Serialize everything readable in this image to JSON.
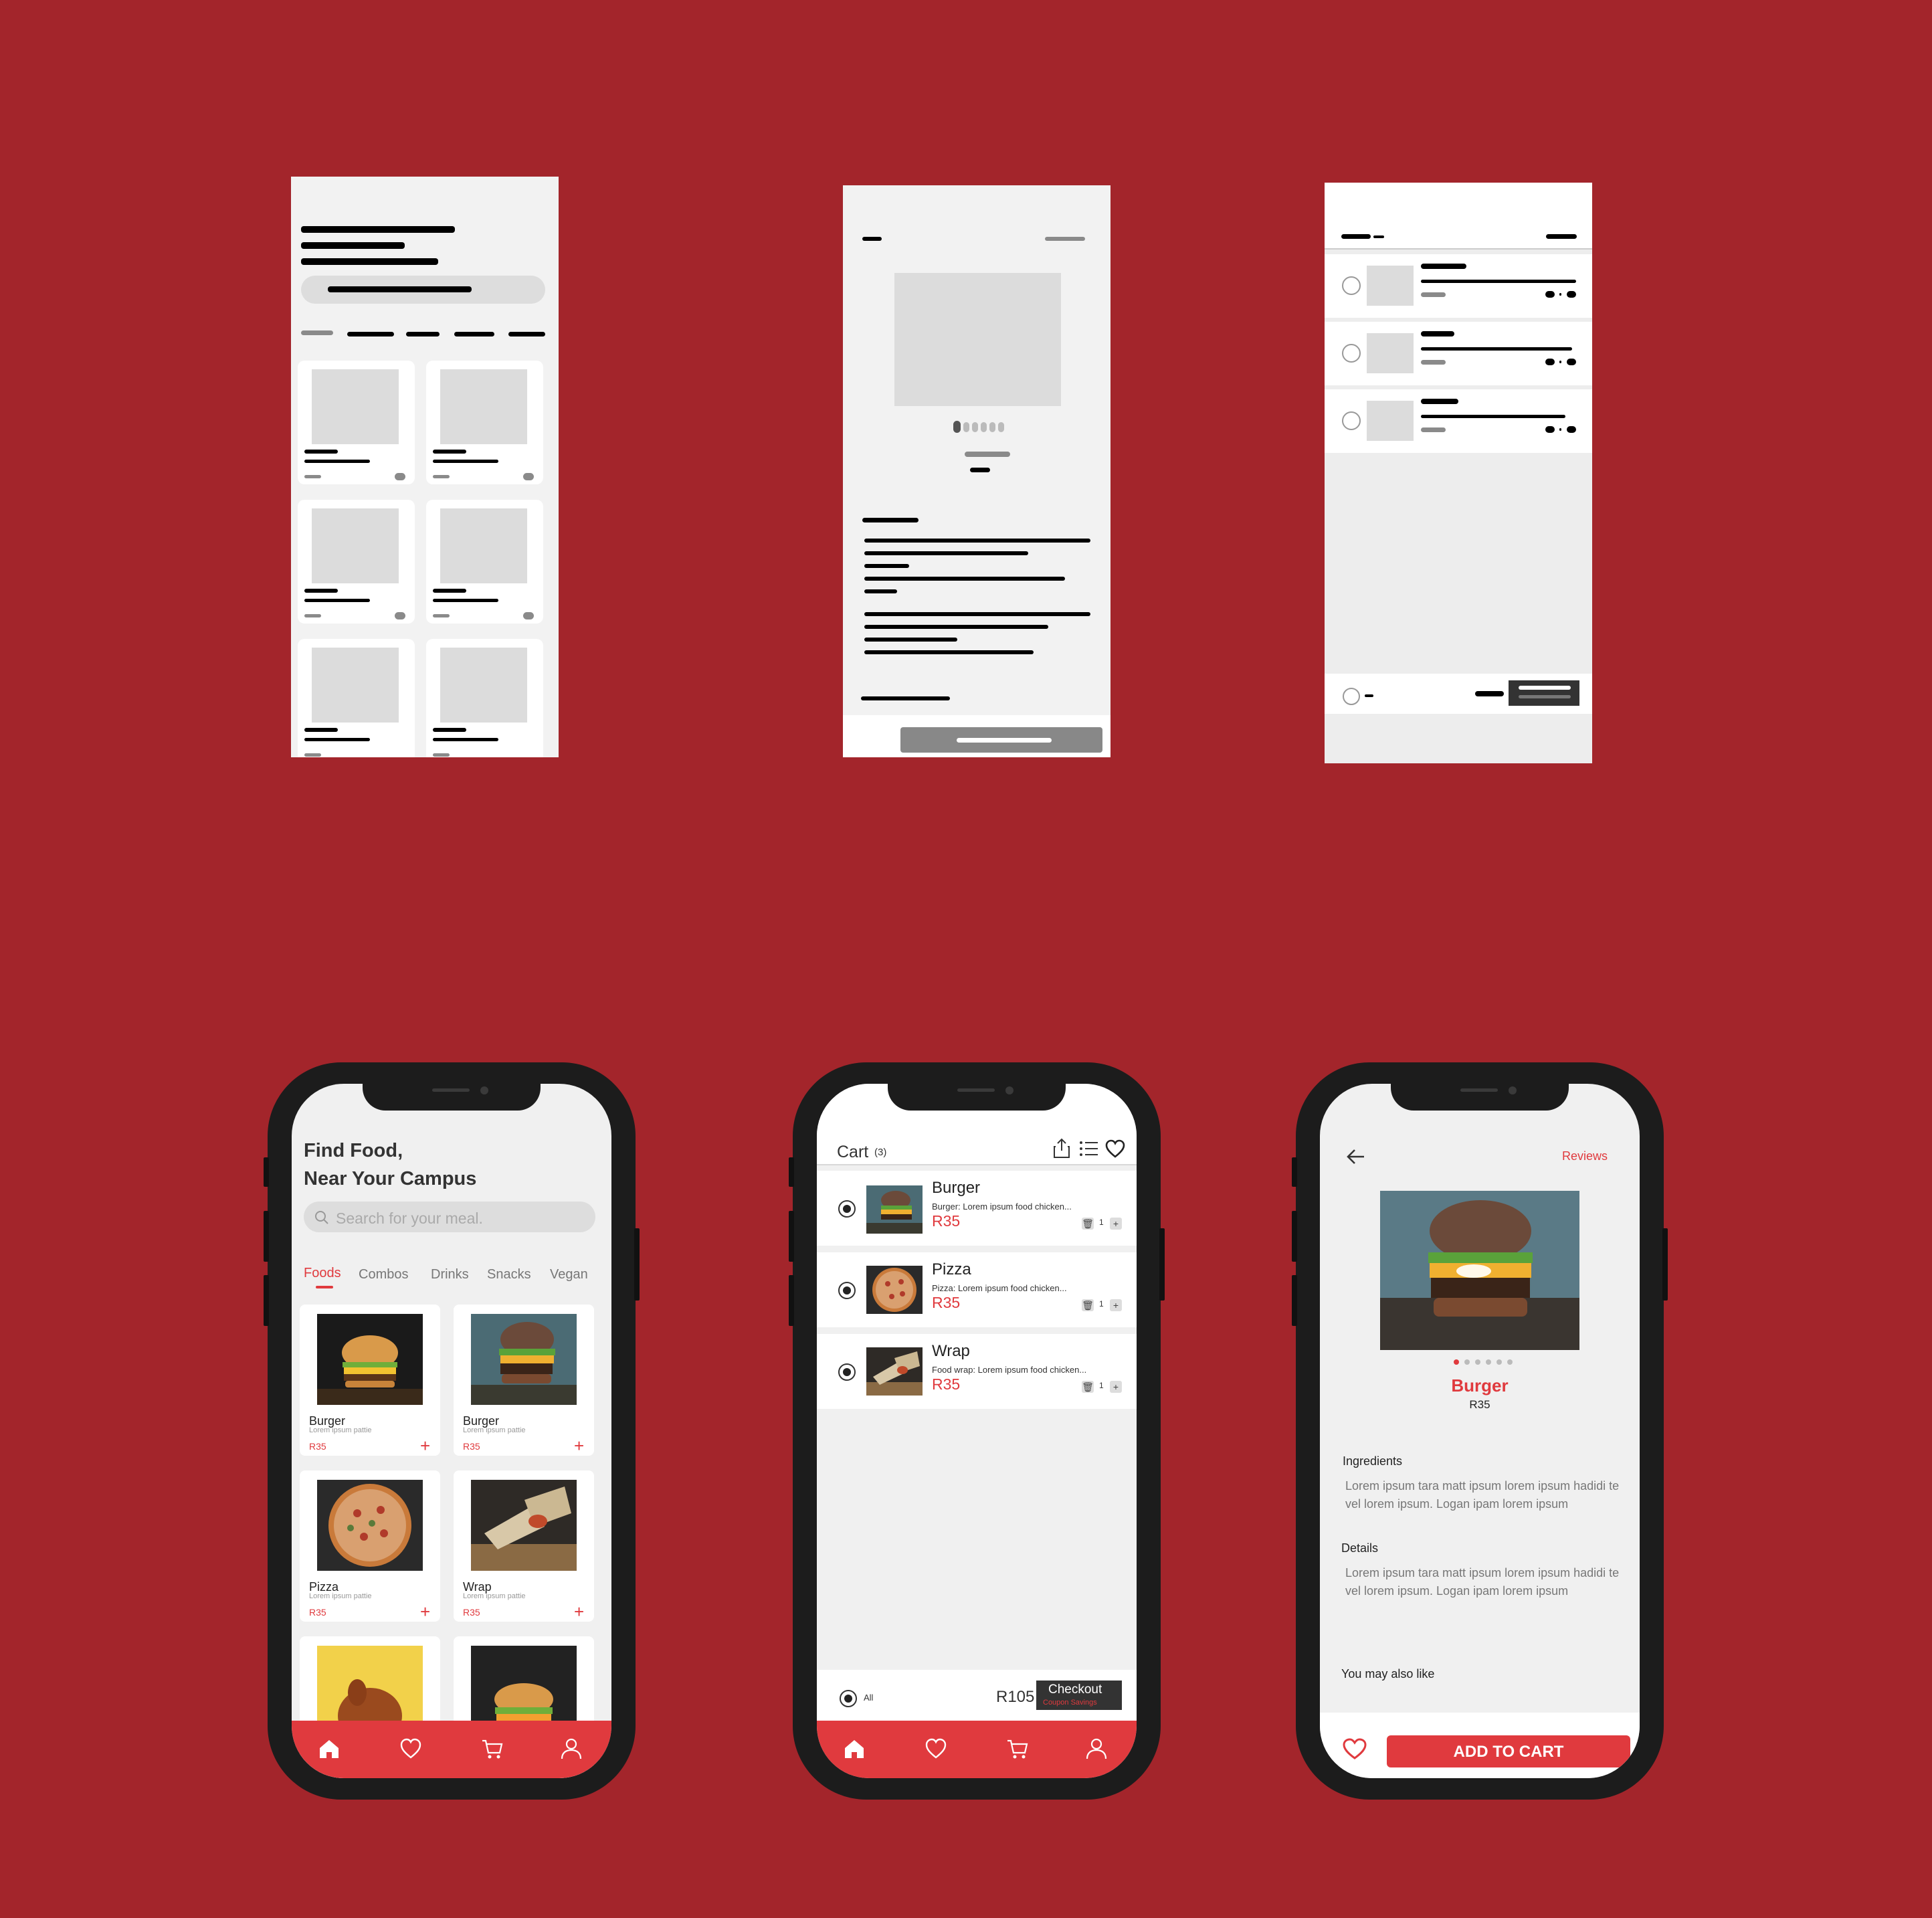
{
  "colors": {
    "background": "#a3252b",
    "accent": "#e03a3e",
    "dark": "#1c1c1c"
  },
  "home": {
    "title_line1": "Find Food,",
    "title_line2": "Near Your Campus",
    "search_placeholder": "Search for your meal.",
    "tabs": [
      "Foods",
      "Combos",
      "Drinks",
      "Snacks",
      "Vegan"
    ],
    "active_tab": "Foods",
    "items": [
      {
        "name": "Burger",
        "desc": "Lorem ipsum pattie",
        "price": "R35",
        "image": "burger-dark"
      },
      {
        "name": "Burger",
        "desc": "Lorem ipsum pattie",
        "price": "R35",
        "image": "burger-egg"
      },
      {
        "name": "Pizza",
        "desc": "Lorem ipsum pattie",
        "price": "R35",
        "image": "pizza"
      },
      {
        "name": "Wrap",
        "desc": "Lorem ipsum pattie",
        "price": "R35",
        "image": "wrap"
      },
      {
        "name": "",
        "desc": "",
        "price": "",
        "image": "chicken"
      },
      {
        "name": "",
        "desc": "",
        "price": "",
        "image": "burger-dark"
      }
    ],
    "add_symbol": "+"
  },
  "cart": {
    "title": "Cart",
    "count": "(3)",
    "items": [
      {
        "name": "Burger",
        "desc": "Burger: Lorem ipsum food chicken...",
        "price": "R35",
        "qty": "1"
      },
      {
        "name": "Pizza",
        "desc": "Pizza: Lorem ipsum food chicken...",
        "price": "R35",
        "qty": "1"
      },
      {
        "name": "Wrap",
        "desc": "Food wrap: Lorem ipsum food chicken...",
        "price": "R35",
        "qty": "1"
      }
    ],
    "select_all_label": "All",
    "total": "R105",
    "checkout_label": "Checkout",
    "coupon_label": "Coupon Savings"
  },
  "detail": {
    "reviews_link": "Reviews",
    "name": "Burger",
    "price": "R35",
    "ingredients_heading": "Ingredients",
    "ingredients_text": "Lorem ipsum tara matt ipsum lorem ipsum hadidi te vel lorem ipsum. Logan ipam lorem ipsum",
    "details_heading": "Details",
    "details_text": "Lorem ipsum tara matt ipsum lorem ipsum hadidi te vel lorem ipsum. Logan ipam lorem ipsum",
    "also_like_heading": "You may also like",
    "add_to_cart_label": "ADD TO CART",
    "carousel_total": 6,
    "carousel_active": 1
  },
  "icons": [
    "home-icon",
    "heart-icon",
    "cart-icon",
    "user-icon",
    "search-icon",
    "share-icon",
    "list-icon",
    "back-arrow-icon",
    "trash-icon",
    "plus-icon"
  ]
}
